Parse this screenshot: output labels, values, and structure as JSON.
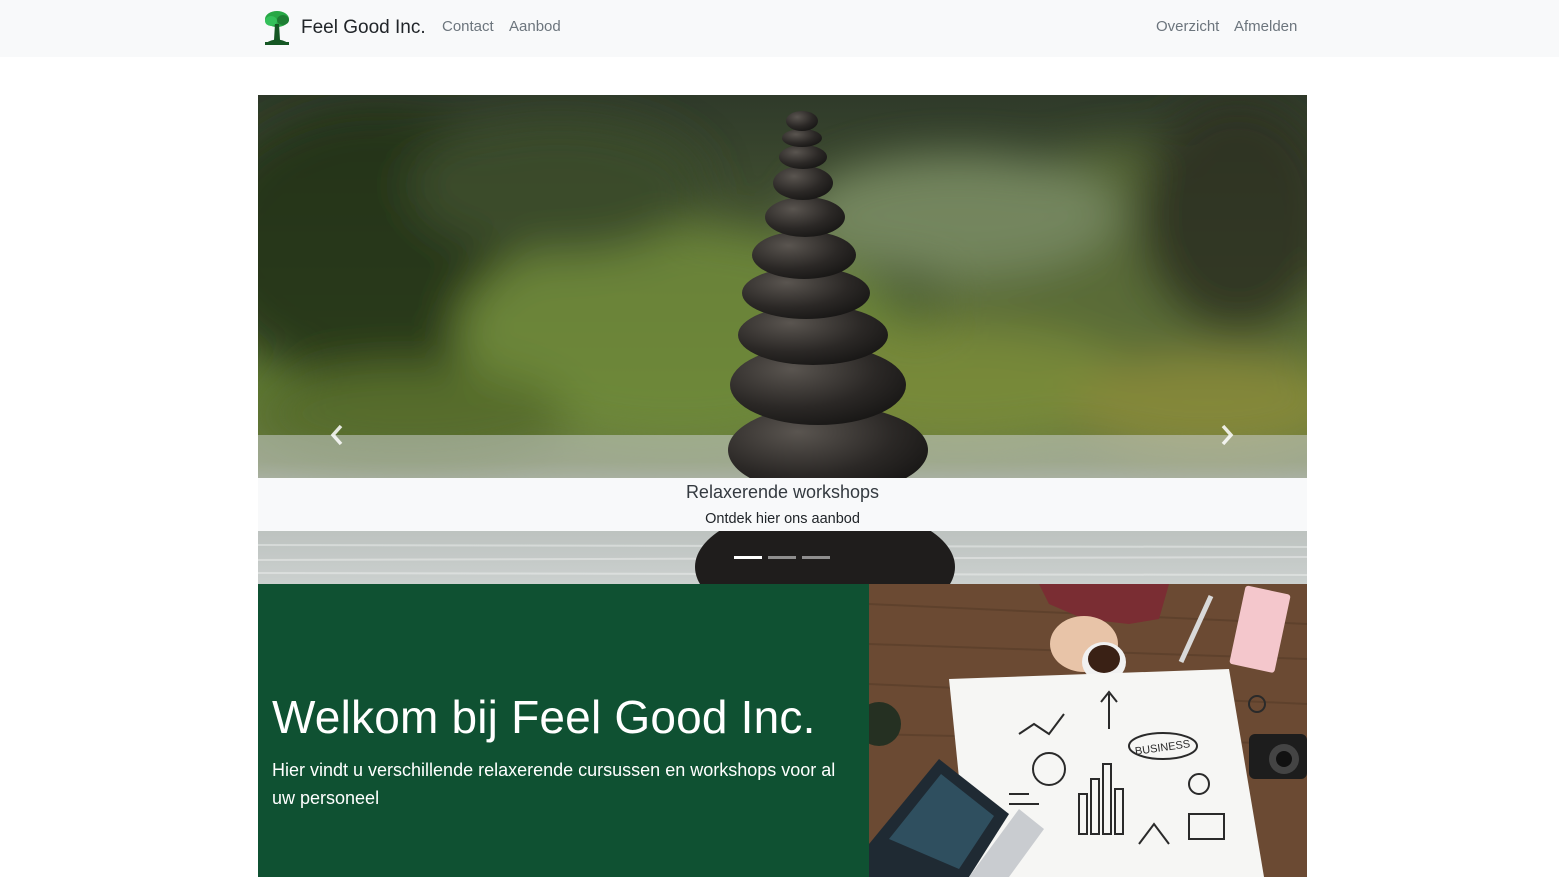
{
  "navbar": {
    "brand": "Feel Good Inc.",
    "logo_icon": "tree-icon",
    "left_links": [
      "Contact",
      "Aanbod"
    ],
    "right_links": [
      "Overzicht",
      "Afmelden"
    ]
  },
  "carousel": {
    "caption_title": "Relaxerende workshops",
    "caption_text": "Ontdek hier ons aanbod",
    "prev_icon": "chevron-left-icon",
    "next_icon": "chevron-right-icon",
    "slide_count": 3,
    "active_slide": 1
  },
  "jumbotron": {
    "title": "Welkom bij Feel Good Inc.",
    "lead": "Hier vindt u verschillende relaxerende cursussen en workshops voor al uw personeel",
    "background_color": "#0f5132"
  },
  "desk_image": {
    "word": "BUSINESS"
  }
}
